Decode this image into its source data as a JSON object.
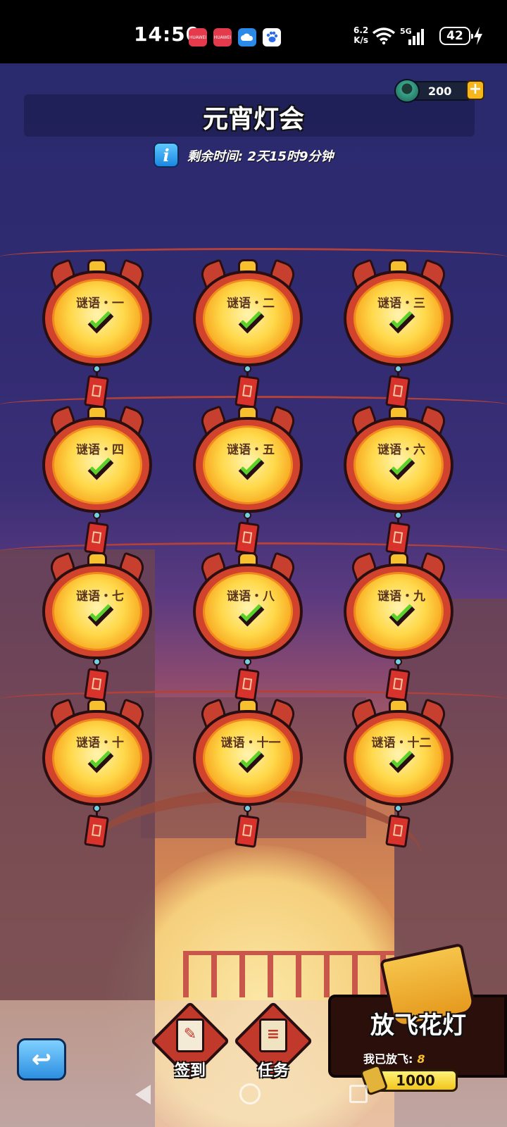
{
  "status_bar": {
    "time": "14:50",
    "net_speed_value": "6.2",
    "net_speed_unit": "K/s",
    "network": "5G",
    "battery": "42",
    "apps": [
      {
        "name": "huawei-store-icon",
        "label": "HUAWEI"
      },
      {
        "name": "huawei-store-icon-2",
        "label": "HUAWEI"
      },
      {
        "name": "cloud-app-icon",
        "label": ""
      },
      {
        "name": "baidu-app-icon",
        "label": ""
      }
    ]
  },
  "header": {
    "title": "元宵灯会",
    "remaining_time": "剩余时间: 2天15时9分钟",
    "info_icon": "i"
  },
  "currency": {
    "value": "200",
    "plus": "+"
  },
  "lanterns": [
    {
      "label": "谜语・一",
      "status": "completed"
    },
    {
      "label": "谜语・二",
      "status": "completed"
    },
    {
      "label": "谜语・三",
      "status": "completed"
    },
    {
      "label": "谜语・四",
      "status": "completed"
    },
    {
      "label": "谜语・五",
      "status": "completed"
    },
    {
      "label": "谜语・六",
      "status": "completed"
    },
    {
      "label": "谜语・七",
      "status": "completed"
    },
    {
      "label": "谜语・八",
      "status": "completed"
    },
    {
      "label": "谜语・九",
      "status": "completed"
    },
    {
      "label": "谜语・十",
      "status": "completed"
    },
    {
      "label": "谜语・十一",
      "status": "completed"
    },
    {
      "label": "谜语・十二",
      "status": "completed"
    }
  ],
  "bottom": {
    "back_icon": "↩",
    "signin_label": "签到",
    "tasks_label": "任务",
    "fly_title": "放飞花灯",
    "fly_count_label": "我已放飞:",
    "fly_count_value": "8",
    "fly_cost": "1000"
  },
  "colors": {
    "check": "#5ad22a",
    "lantern_body": "#d2432e",
    "lantern_glow": "#ffd94a",
    "accent_gold": "#f7c02e"
  }
}
